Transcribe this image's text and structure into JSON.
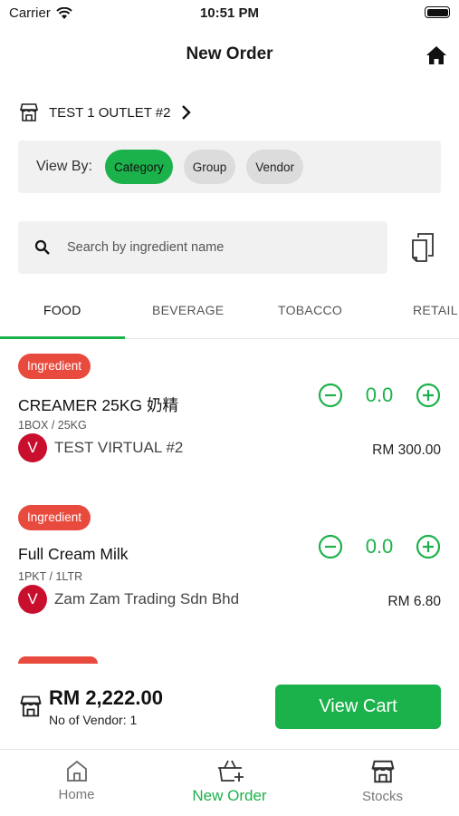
{
  "status_bar": {
    "carrier": "Carrier",
    "time": "10:51 PM"
  },
  "nav": {
    "title": "New Order"
  },
  "outlet": {
    "name": "TEST 1 OUTLET #2"
  },
  "view_by": {
    "label": "View By:",
    "options": [
      "Category",
      "Group",
      "Vendor"
    ],
    "selected": "Category"
  },
  "search": {
    "placeholder": "Search by ingredient name"
  },
  "tabs": [
    "FOOD",
    "BEVERAGE",
    "TOBACCO",
    "RETAIL"
  ],
  "active_tab": "FOOD",
  "items": [
    {
      "badge": "Ingredient",
      "name": "CREAMER 25KG 奶精",
      "unit": "1BOX / 25KG",
      "vendor_initial": "V",
      "vendor": "TEST VIRTUAL #2",
      "price": "RM 300.00",
      "qty": "0.0"
    },
    {
      "badge": "Ingredient",
      "name": "Full Cream Milk",
      "unit": "1PKT / 1LTR",
      "vendor_initial": "V",
      "vendor": "Zam Zam Trading Sdn Bhd",
      "price": "RM 6.80",
      "qty": "0.0"
    }
  ],
  "summary": {
    "total": "RM 2,222.00",
    "vendor_count": "No of Vendor: 1",
    "cart_button": "View Cart"
  },
  "tabbar": {
    "items": [
      {
        "label": "Home",
        "icon": "home-outline-icon"
      },
      {
        "label": "New Order",
        "icon": "basket-plus-icon"
      },
      {
        "label": "Stocks",
        "icon": "store-icon"
      }
    ],
    "active": "New Order"
  },
  "colors": {
    "accent": "#1cb24b",
    "badge": "#e84a3e",
    "vendor_avatar": "#c8102e"
  }
}
